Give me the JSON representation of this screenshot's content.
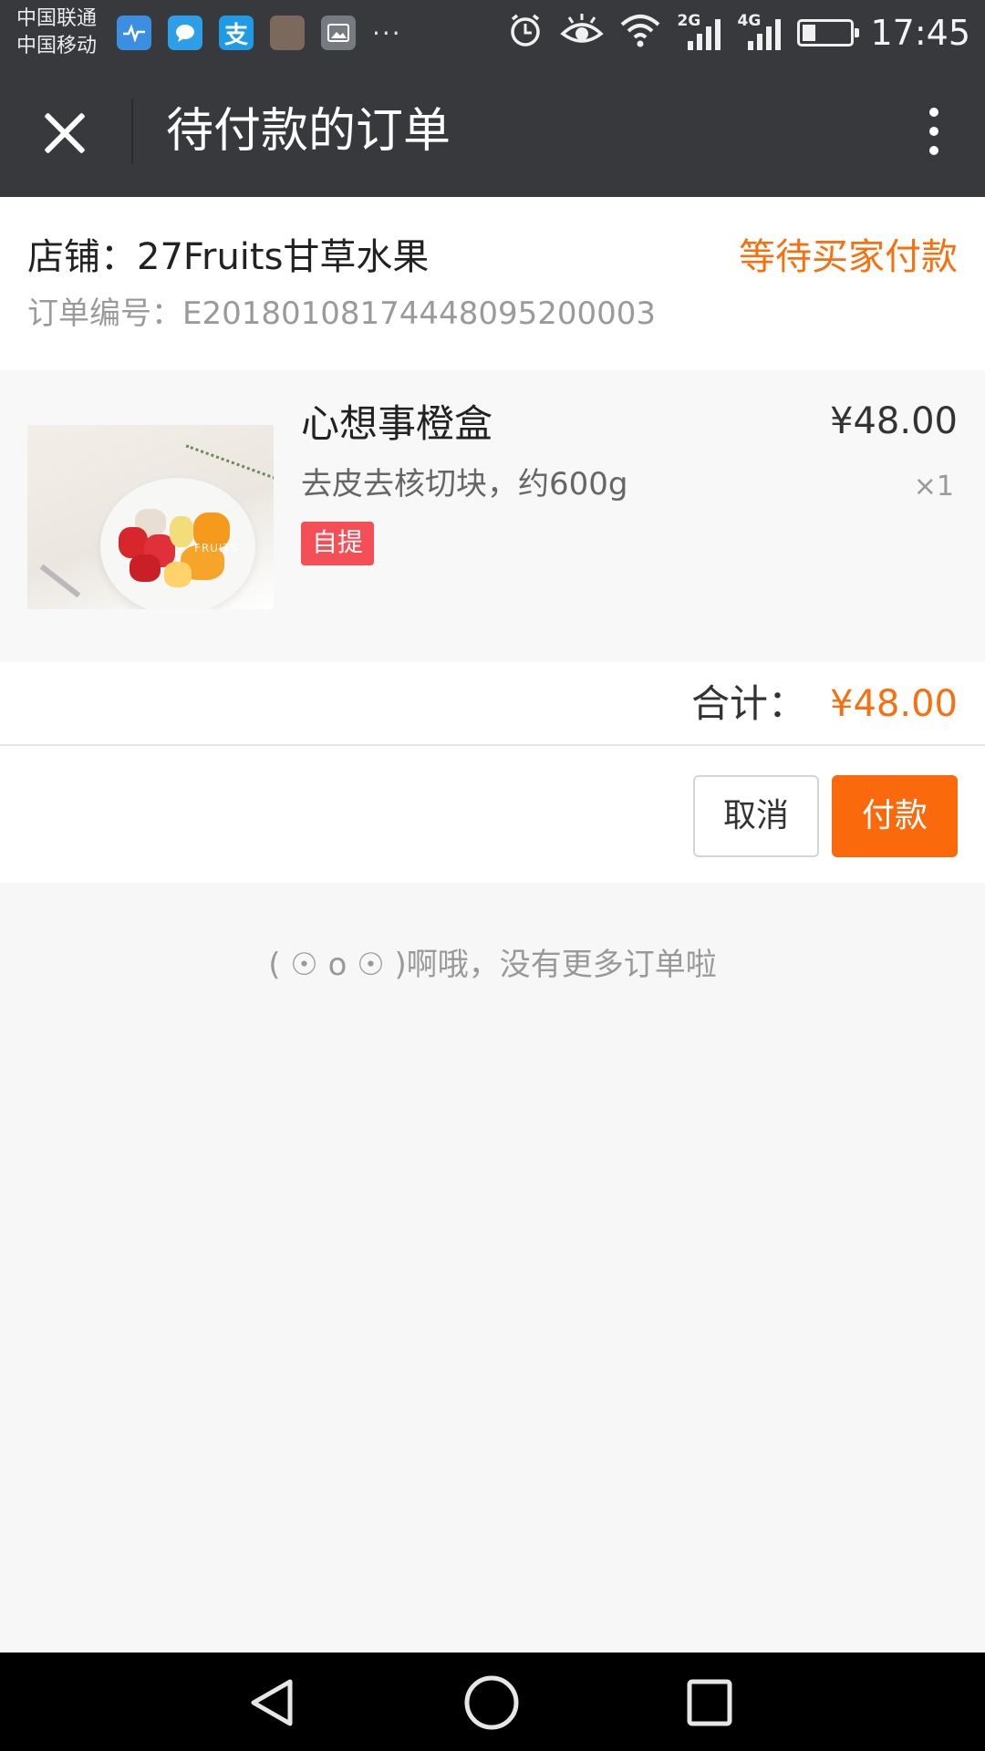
{
  "status_bar": {
    "carrier_1": "中国联通",
    "carrier_2": "中国移动",
    "alipay_glyph": "支",
    "more": "···",
    "net_1": "2G",
    "net_2": "4G",
    "time": "17:45",
    "icons": [
      "health-app-icon",
      "chat-app-icon",
      "alipay-app-icon",
      "gallery-app-icon",
      "photo-app-icon",
      "alarm-icon",
      "eye-comfort-icon",
      "wifi-icon",
      "signal-icon",
      "battery-icon"
    ]
  },
  "header": {
    "title": "待付款的订单",
    "close_icon": "close-icon",
    "more_icon": "more-vertical-icon"
  },
  "order": {
    "store": "店铺：27Fruits甘草水果",
    "status": "等待买家付款",
    "order_no": "订单编号：E20180108174448095200003",
    "item": {
      "name": "心想事橙盒",
      "spec": "去皮去核切块，约600g",
      "tag": "自提",
      "price": "¥48.00",
      "qty": "×1",
      "image_watermark": "FRUITS"
    },
    "total_label": "合计：",
    "total_value": "¥48.00",
    "cancel_label": "取消",
    "pay_label": "付款"
  },
  "no_more_text": "( ☉ o ☉ )啊哦，没有更多订单啦",
  "colors": {
    "accent": "#f86f0f",
    "bar_bg": "#38393d",
    "tag_red": "#f44f56",
    "page_bg": "#f7f7f7"
  }
}
